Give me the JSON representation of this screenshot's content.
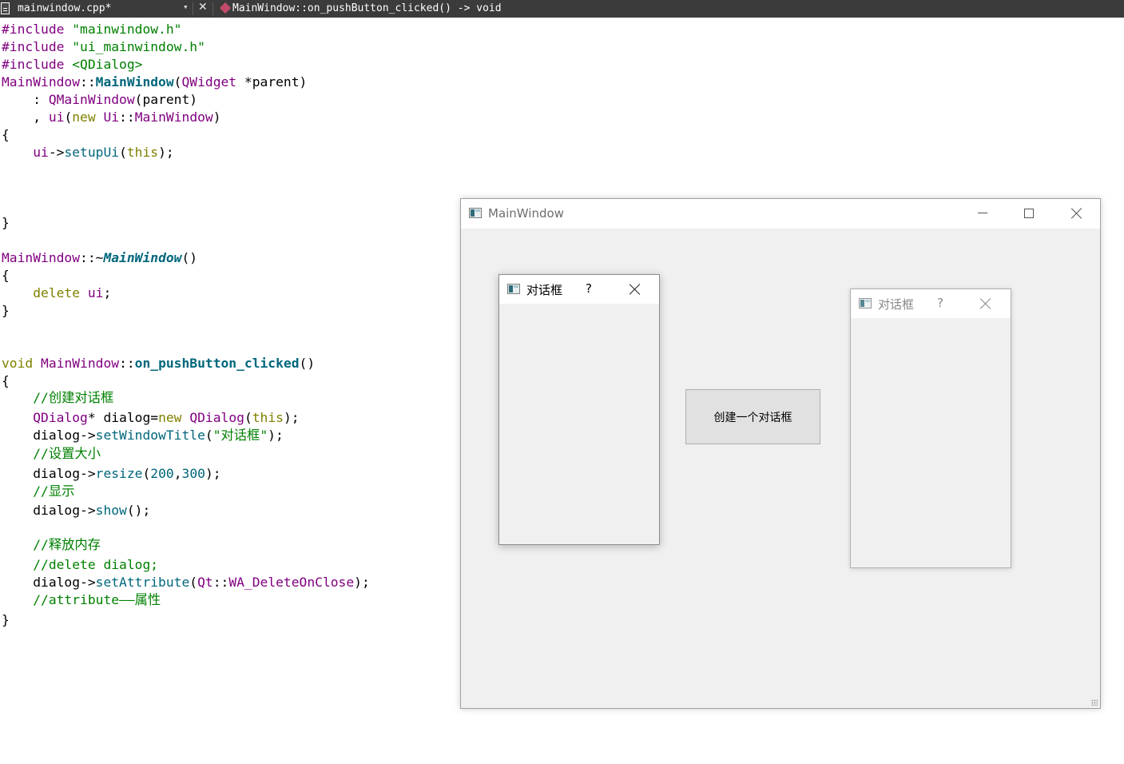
{
  "editor": {
    "file_name": "mainwindow.cpp*",
    "function_signature": "MainWindow::on_pushButton_clicked() -> void"
  },
  "code": {
    "include1_kw": "#include",
    "include1_val": "\"mainwindow.h\"",
    "include2_kw": "#include",
    "include2_val": "\"ui_mainwindow.h\"",
    "include3_kw": "#include",
    "include3_val": "<QDialog>",
    "comment_create": "//创建对话框",
    "comment_resize": "//设置大小",
    "comment_show": "//显示",
    "comment_release": "//释放内存",
    "comment_delete": "//delete dialog;",
    "comment_attribute": "//attribute——属性",
    "window_title_arg": "\"对话框\""
  },
  "main_window": {
    "title": "MainWindow",
    "button_label": "创建一个对话框"
  },
  "dialogs": [
    {
      "title": "对话框",
      "help": "?",
      "active": true
    },
    {
      "title": "对话框",
      "help": "?",
      "active": false
    }
  ]
}
